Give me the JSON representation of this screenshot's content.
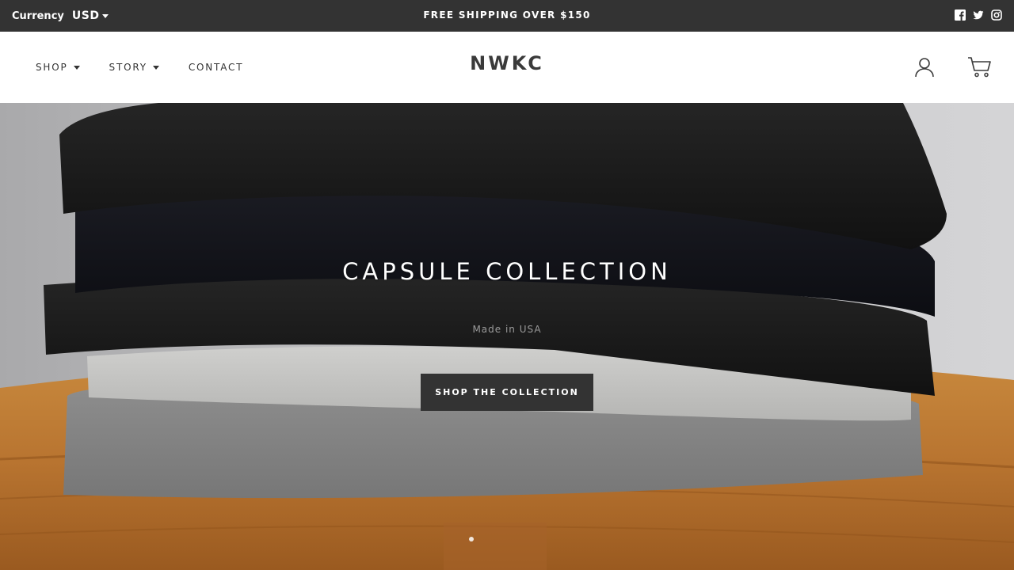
{
  "topbar": {
    "currency_label": "Currency",
    "currency_value": "USD",
    "promo": "FREE SHIPPING OVER $150",
    "social_icons": [
      "facebook-icon",
      "twitter-icon",
      "instagram-icon"
    ]
  },
  "header": {
    "nav": [
      {
        "label": "SHOP",
        "dropdown": true
      },
      {
        "label": "STORY",
        "dropdown": true
      },
      {
        "label": "CONTACT",
        "dropdown": false
      }
    ],
    "logo": "NWKC",
    "icons": [
      "user-icon",
      "cart-icon"
    ]
  },
  "hero": {
    "title": "CAPSULE COLLECTION",
    "subtitle": "Made in USA",
    "cta": "SHOP THE COLLECTION",
    "slide_count": 1,
    "active_slide": 1
  },
  "colors": {
    "topbar_bg": "#333333",
    "button_bg": "#333333",
    "text_dark": "#333333",
    "header_bg": "#ffffff"
  }
}
